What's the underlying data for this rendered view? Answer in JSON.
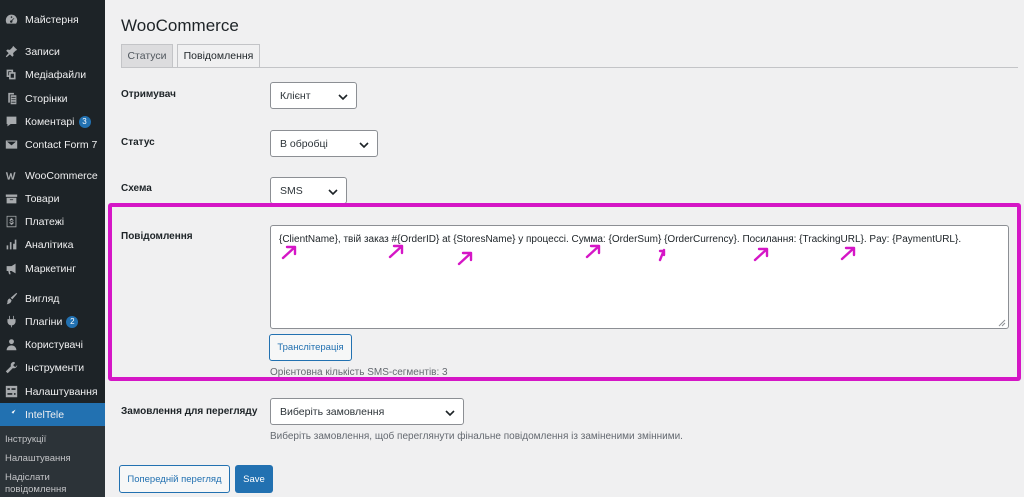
{
  "sidebar": {
    "items": [
      {
        "label": "Майстерня",
        "icon": "dashboard-icon"
      },
      {
        "label": "Записи",
        "icon": "pin-icon"
      },
      {
        "label": "Медіафайли",
        "icon": "media-icon"
      },
      {
        "label": "Сторінки",
        "icon": "pages-icon"
      },
      {
        "label": "Коментарі",
        "icon": "comments-icon",
        "badge": "3"
      },
      {
        "label": "Contact Form 7",
        "icon": "mail-icon"
      },
      {
        "label": "WooCommerce",
        "icon": "woocommerce-icon"
      },
      {
        "label": "Товари",
        "icon": "products-icon"
      },
      {
        "label": "Платежі",
        "icon": "payments-icon"
      },
      {
        "label": "Аналітика",
        "icon": "analytics-icon"
      },
      {
        "label": "Маркетинг",
        "icon": "megaphone-icon"
      },
      {
        "label": "Вигляд",
        "icon": "brush-icon"
      },
      {
        "label": "Плагіни",
        "icon": "plugin-icon",
        "badge": "2"
      },
      {
        "label": "Користувачі",
        "icon": "users-icon"
      },
      {
        "label": "Інструменти",
        "icon": "tools-icon"
      },
      {
        "label": "Налаштування",
        "icon": "settings-icon"
      },
      {
        "label": "IntelTele",
        "icon": "inteltele-icon"
      }
    ],
    "submenu": [
      "Інструкції",
      "Налаштування",
      "Надіслати повідомлення"
    ]
  },
  "page": {
    "title": "WooCommerce",
    "tabs": [
      "Статуси",
      "Повідомлення"
    ]
  },
  "form": {
    "recipient_label": "Отримувач",
    "recipient_value": "Клієнт",
    "status_label": "Статус",
    "status_value": "В обробці",
    "scheme_label": "Схема",
    "scheme_value": "SMS",
    "message_label": "Повідомлення",
    "message_text": "{ClientName}, твій заказ #{OrderID} at {StoresName} у процессі. Сумма: {OrderSum} {OrderCurrency}. Посилання: {TrackingURL}. Pay: {PaymentURL}.",
    "transliteration_button": "Транслітерація",
    "sms_segments": "Орієнтовна кількість SMS-сегментів: 3",
    "preview_order_label": "Замовлення для перегляду",
    "preview_order_placeholder": "Виберіть замовлення",
    "preview_order_hint": "Виберіть замовлення, щоб переглянути фінальне повідомлення із заміненими змінними.",
    "preview_button": "Попередній перегляд",
    "save_button": "Save"
  },
  "colors": {
    "accent": "#2271b1",
    "annotation": "#d516c6",
    "sidebar_bg": "#1d2327"
  }
}
